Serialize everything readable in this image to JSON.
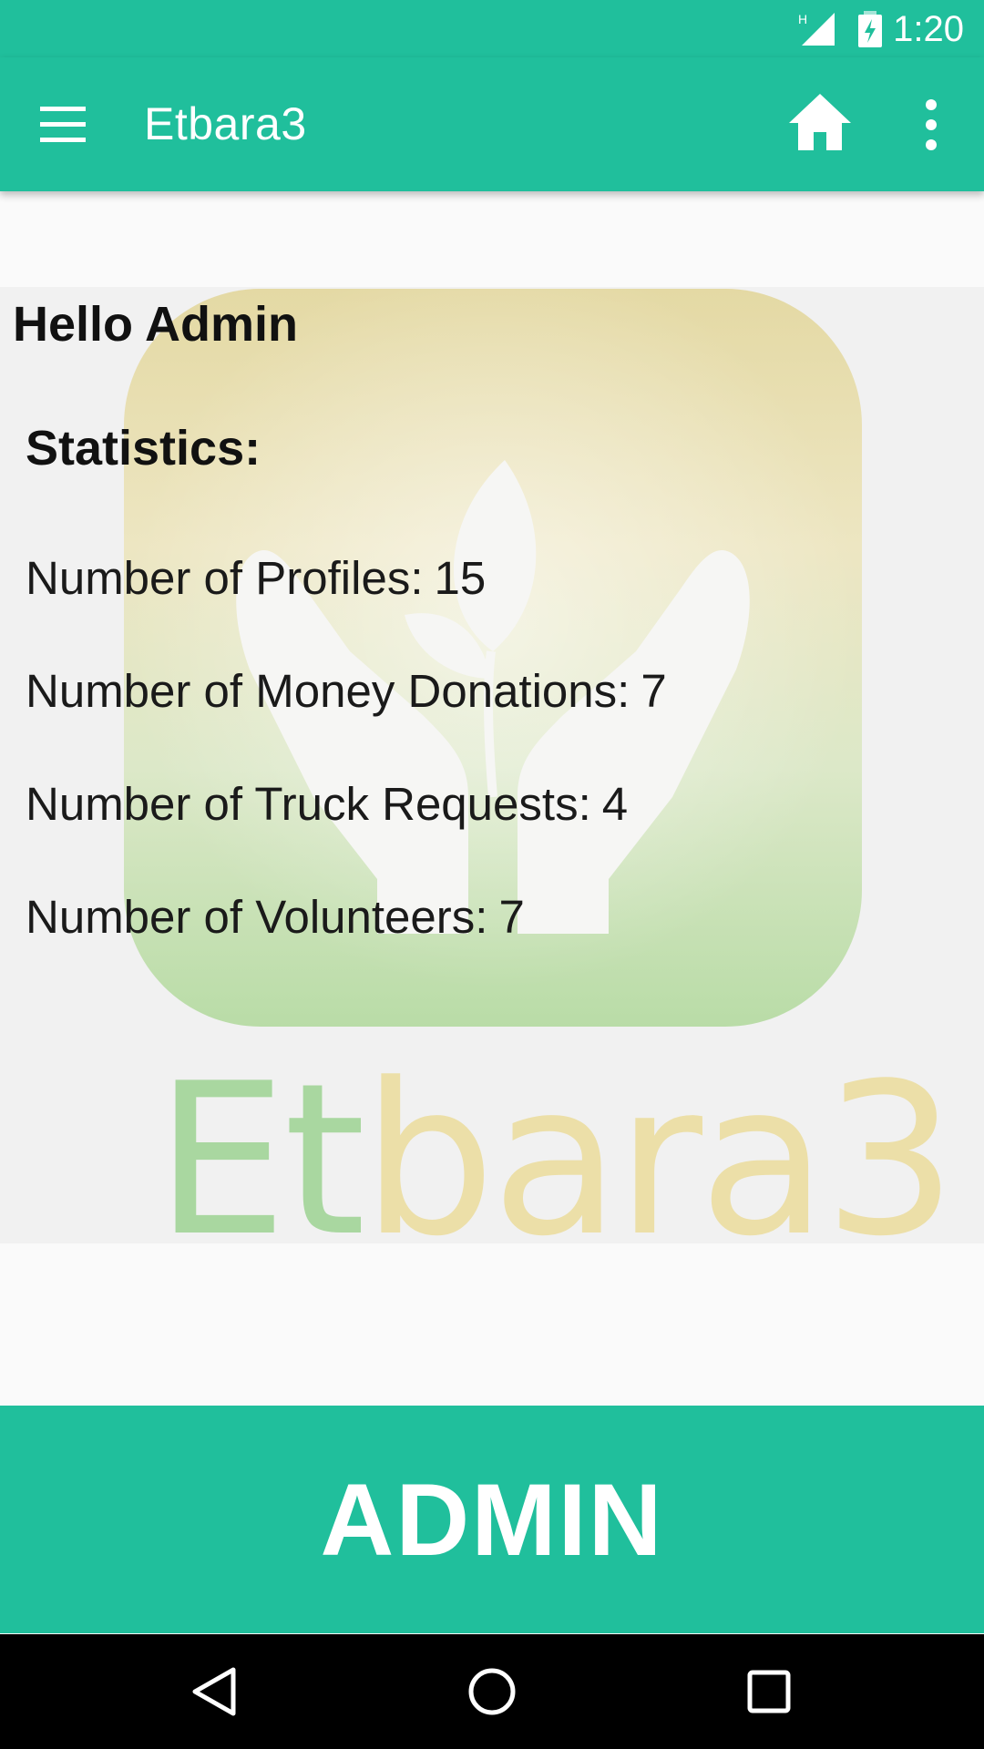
{
  "status_bar": {
    "time": "1:20",
    "network": "H",
    "icons": [
      "signal-icon",
      "battery-charging-icon"
    ]
  },
  "app_bar": {
    "title": "Etbara3",
    "icons": [
      "menu-icon",
      "home-icon",
      "more-vert-icon"
    ]
  },
  "content": {
    "greeting": "Hello Admin",
    "stats_heading": "Statistics:",
    "stats": [
      {
        "label": "Number of Profiles:",
        "value": "15"
      },
      {
        "label": "Number of Money Donations:",
        "value": "7"
      },
      {
        "label": "Number of Truck Requests:",
        "value": "4"
      },
      {
        "label": "Number of Volunteers:",
        "value": "7"
      }
    ],
    "background_logo": {
      "word_part1": "Et",
      "word_part2": "bara3"
    }
  },
  "role_banner": {
    "label": "ADMIN"
  },
  "nav_bar": {
    "icons": [
      "back-icon",
      "home-circle-icon",
      "recents-icon"
    ]
  },
  "colors": {
    "primary": "#20bf9c",
    "panel": "#f1f1f1",
    "background": "#fafafa"
  }
}
